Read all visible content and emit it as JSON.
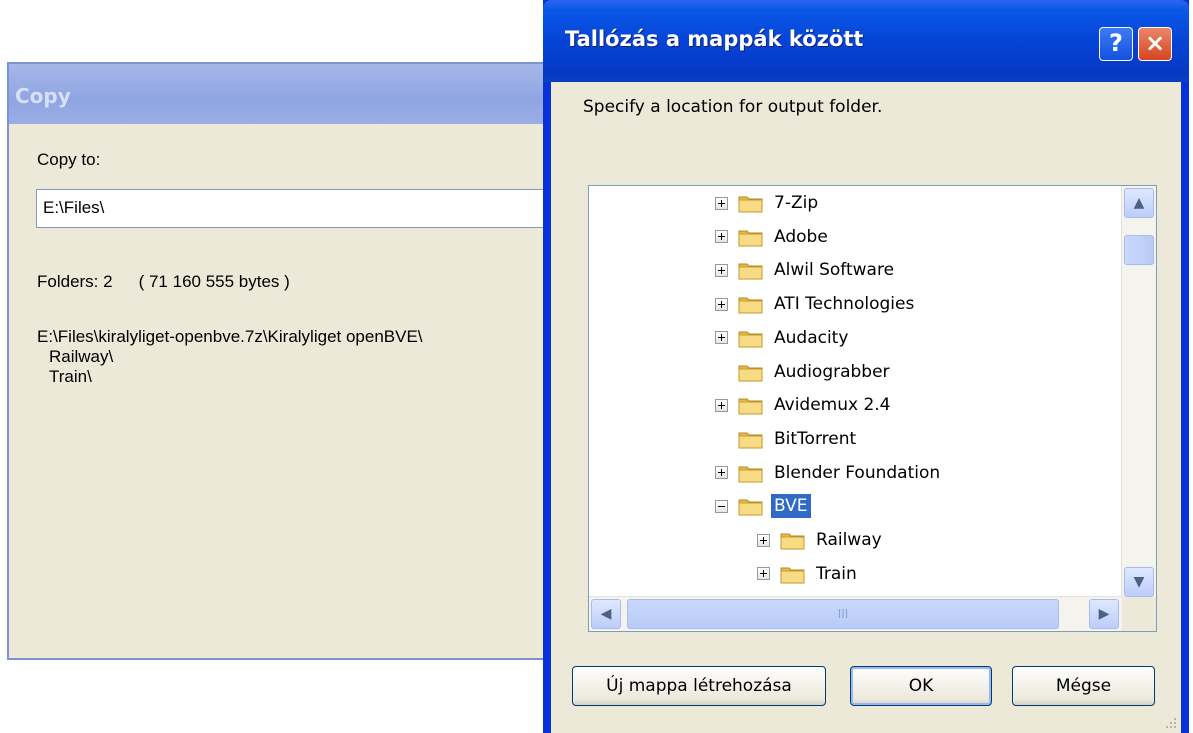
{
  "copy_window": {
    "title": "Copy",
    "label": "Copy to:",
    "path_value": "E:\\Files\\",
    "folders_text": "Folders: 2",
    "bytes_text": "( 71 160 555 bytes )",
    "paths": [
      "E:\\Files\\kiralyliget-openbve.7z\\Kiralyliget openBVE\\",
      "Railway\\",
      "Train\\"
    ]
  },
  "browse_dialog": {
    "title": "Tallózás a mappák között",
    "help_label": "?",
    "close_label": "×",
    "message": "Specify a location for output folder.",
    "tree_items": [
      {
        "label": "7-Zip",
        "expander": "plus",
        "depth": 0
      },
      {
        "label": "Adobe",
        "expander": "plus",
        "depth": 0
      },
      {
        "label": "Alwil Software",
        "expander": "plus",
        "depth": 0
      },
      {
        "label": "ATI Technologies",
        "expander": "plus",
        "depth": 0
      },
      {
        "label": "Audacity",
        "expander": "plus",
        "depth": 0
      },
      {
        "label": "Audiograbber",
        "expander": "none",
        "depth": 0
      },
      {
        "label": "Avidemux 2.4",
        "expander": "plus",
        "depth": 0
      },
      {
        "label": "BitTorrent",
        "expander": "none",
        "depth": 0
      },
      {
        "label": "Blender Foundation",
        "expander": "plus",
        "depth": 0
      },
      {
        "label": "BVE",
        "expander": "minus",
        "depth": 0,
        "selected": true
      },
      {
        "label": "Railway",
        "expander": "plus",
        "depth": 1
      },
      {
        "label": "Train",
        "expander": "plus",
        "depth": 1
      }
    ],
    "hscroll_thumb_grip": "III",
    "scroll_up": "▲",
    "scroll_down": "▼",
    "scroll_left": "◀",
    "scroll_right": "▶",
    "buttons": {
      "new_folder": "Új mappa létrehozása",
      "ok": "OK",
      "cancel": "Mégse"
    }
  },
  "colors": {
    "titlebar_active": "#0644d6",
    "titlebar_inactive": "#9aaee6",
    "dialog_face": "#ece9d8",
    "selection": "#316ac5",
    "folder_yellow": "#f5d67a"
  }
}
